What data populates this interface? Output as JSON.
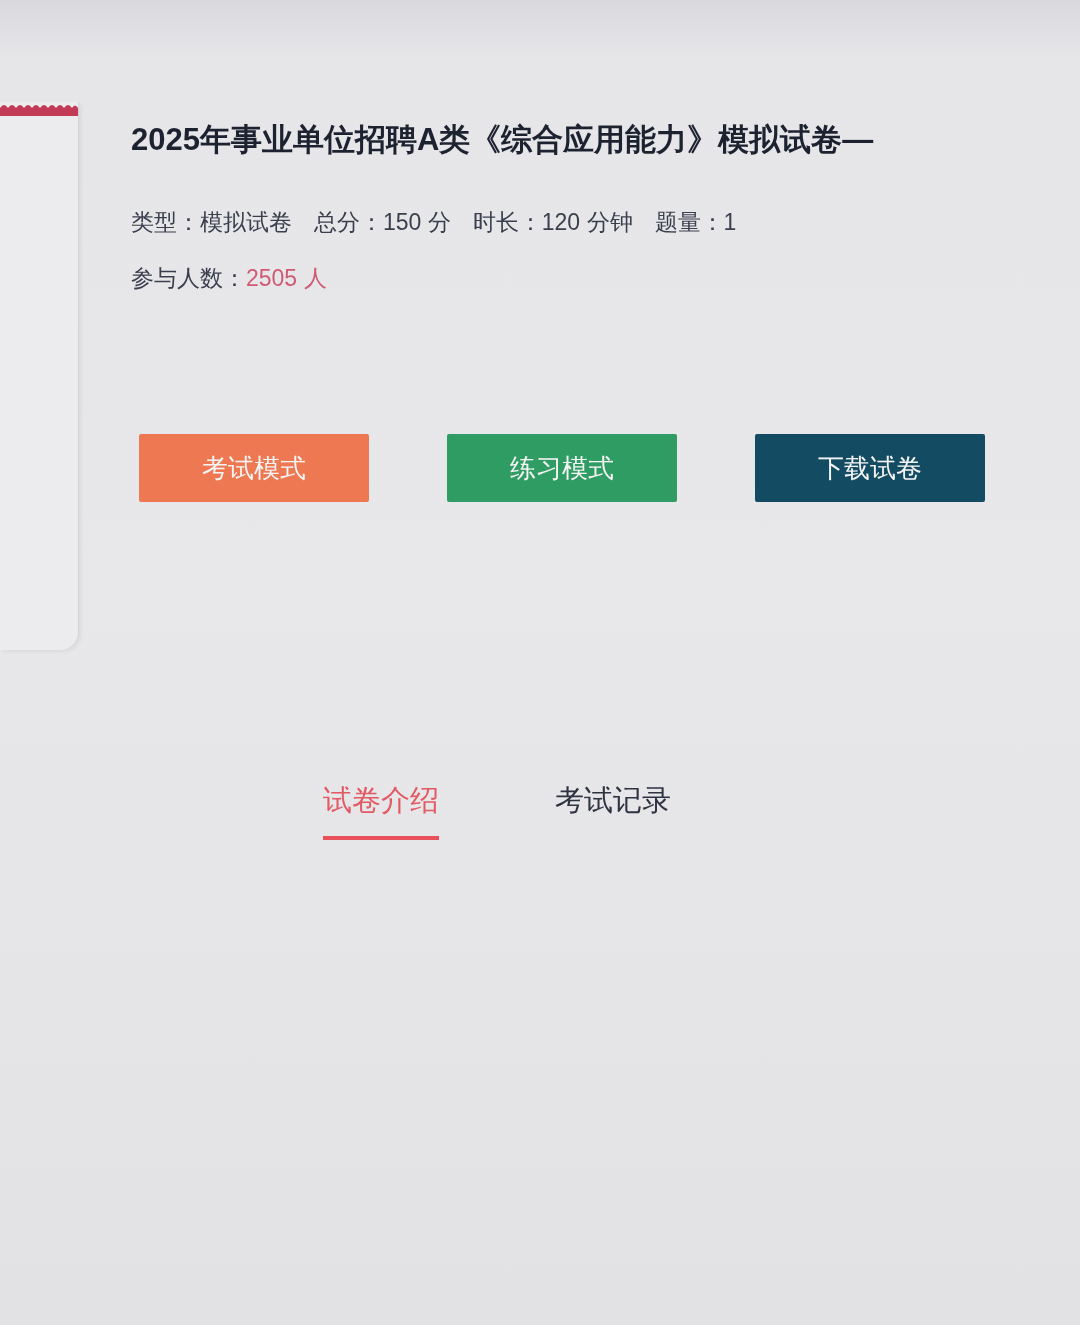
{
  "title": "2025年事业单位招聘A类《综合应用能力》模拟试卷—",
  "meta": [
    {
      "text": "类型：模拟试卷"
    },
    {
      "text": "总分：150 分"
    },
    {
      "text": "时长：120 分钟"
    },
    {
      "text": "题量：1"
    }
  ],
  "participants": {
    "label": "参与人数：",
    "value": "2505 人"
  },
  "buttons": [
    {
      "label": "考试模式",
      "kind": "exam"
    },
    {
      "label": "练习模式",
      "kind": "practice"
    },
    {
      "label": "下载试卷",
      "kind": "download"
    }
  ],
  "tabs": [
    {
      "label": "试卷介绍",
      "selected": true
    },
    {
      "label": "考试记录",
      "selected": false
    }
  ]
}
